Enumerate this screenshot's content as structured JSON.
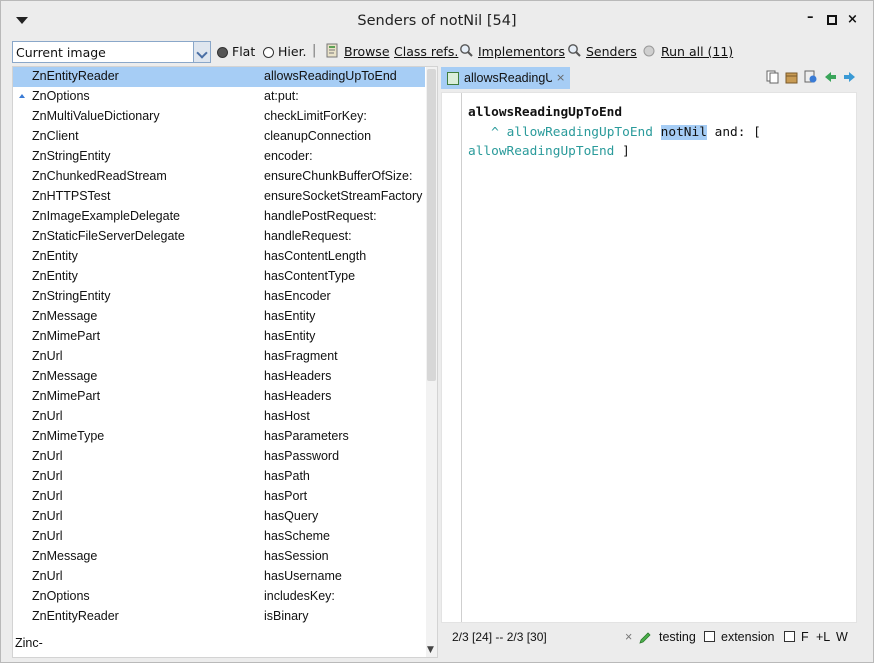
{
  "window": {
    "title": "Senders of notNil [54]",
    "minimize_glyph": "–",
    "close_glyph": "×"
  },
  "toolbar": {
    "scope_value": "Current image",
    "flat_label": "Flat",
    "hier_label": "Hier.",
    "separator": "|",
    "browse_label": "Browse",
    "class_refs_label": "Class refs.",
    "implementors_label": "Implementors",
    "senders_label": "Senders",
    "run_all_label": "Run all (11)"
  },
  "list": {
    "rows": [
      {
        "cls": "ZnEntityReader",
        "sel": "allowsReadingUpToEnd",
        "selected": true
      },
      {
        "cls": "ZnOptions",
        "sel": "at:put:",
        "ext": true
      },
      {
        "cls": "ZnMultiValueDictionary",
        "sel": "checkLimitForKey:"
      },
      {
        "cls": "ZnClient",
        "sel": "cleanupConnection"
      },
      {
        "cls": "ZnStringEntity",
        "sel": "encoder:"
      },
      {
        "cls": "ZnChunkedReadStream",
        "sel": "ensureChunkBufferOfSize:"
      },
      {
        "cls": "ZnHTTPSTest",
        "sel": "ensureSocketStreamFactory"
      },
      {
        "cls": "ZnImageExampleDelegate",
        "sel": "handlePostRequest:"
      },
      {
        "cls": "ZnStaticFileServerDelegate",
        "sel": "handleRequest:"
      },
      {
        "cls": "ZnEntity",
        "sel": "hasContentLength"
      },
      {
        "cls": "ZnEntity",
        "sel": "hasContentType"
      },
      {
        "cls": "ZnStringEntity",
        "sel": "hasEncoder"
      },
      {
        "cls": "ZnMessage",
        "sel": "hasEntity"
      },
      {
        "cls": "ZnMimePart",
        "sel": "hasEntity"
      },
      {
        "cls": "ZnUrl",
        "sel": "hasFragment"
      },
      {
        "cls": "ZnMessage",
        "sel": "hasHeaders"
      },
      {
        "cls": "ZnMimePart",
        "sel": "hasHeaders"
      },
      {
        "cls": "ZnUrl",
        "sel": "hasHost"
      },
      {
        "cls": "ZnMimeType",
        "sel": "hasParameters"
      },
      {
        "cls": "ZnUrl",
        "sel": "hasPassword"
      },
      {
        "cls": "ZnUrl",
        "sel": "hasPath"
      },
      {
        "cls": "ZnUrl",
        "sel": "hasPort"
      },
      {
        "cls": "ZnUrl",
        "sel": "hasQuery"
      },
      {
        "cls": "ZnUrl",
        "sel": "hasScheme"
      },
      {
        "cls": "ZnMessage",
        "sel": "hasSession"
      },
      {
        "cls": "ZnUrl",
        "sel": "hasUsername"
      },
      {
        "cls": "ZnOptions",
        "sel": "includesKey:"
      },
      {
        "cls": "ZnEntityReader",
        "sel": "isBinary"
      }
    ],
    "package_label": "Zinc-"
  },
  "editor": {
    "tab_label": "allowsReadingUpToEnd",
    "tab_close": "×",
    "code": {
      "method_name": "allowsReadingUpToEnd",
      "caret": "^",
      "inst_var": "allowReadingUpToEnd",
      "message": "notNil",
      "and_keyword": "and:",
      "open_bracket": "[",
      "inst_var_2": "allowReadingUpToEnd",
      "close_bracket": "]"
    }
  },
  "status": {
    "position": "2/3 [24] -- 2/3 [30]",
    "x_glyph": "×",
    "protocol": "testing",
    "extension_label": "extension",
    "f_label": "F",
    "l_label": "+L",
    "w_label": "W"
  },
  "colors": {
    "selection": "#a6cdf5",
    "inst_var": "#2b9b9b"
  }
}
